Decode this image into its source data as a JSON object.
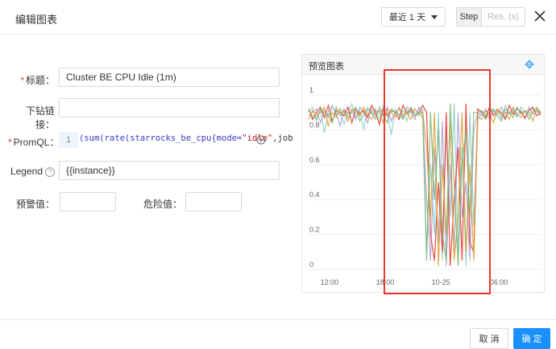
{
  "header": {
    "title": "编辑图表",
    "time_range": "最近 1 天",
    "step_label": "Step",
    "res_placeholder": "Res. (s)"
  },
  "form": {
    "title_label": "标题：",
    "title_value": "Cluster BE CPU Idle (1m)",
    "drilldown_label": "下钻链接：",
    "drilldown_value": "",
    "promql_label": "PromQL：",
    "promql_line_no": "1",
    "promql_code": {
      "p1": "(sum(rate(starrocks_be_cpu{mode=",
      "p2": "\"idle\"",
      "p3": ",job"
    },
    "legend_label": "Legend",
    "legend_value": "{{instance}}",
    "warning_label": "预警值：",
    "warning_value": "",
    "danger_label": "危险值：",
    "danger_value": ""
  },
  "preview": {
    "title": "预览图表"
  },
  "footer": {
    "cancel_label": "取 消",
    "ok_label": "确 定"
  },
  "colors": {
    "accent": "#1890ff",
    "highlight_box": "#e8382f",
    "series": [
      "#8dd3c7",
      "#b0a0d8",
      "#e8382f",
      "#d9a035",
      "#7fb87a"
    ]
  },
  "chart_data": {
    "type": "line",
    "x_ticks": [
      "12:00",
      "18:00",
      "10-25",
      "06:00"
    ],
    "y_ticks": [
      "1",
      "0.8",
      "0.6",
      "0.4",
      "0.2",
      "0"
    ],
    "ylim": [
      0,
      1
    ],
    "grid": true,
    "legend": "none",
    "series": [
      {
        "values": [
          0.9,
          0.93,
          0.85,
          0.92,
          0.78,
          0.91,
          0.94,
          0.88,
          0.92,
          0.83,
          0.9,
          0.95,
          0.87,
          0.91,
          0.8,
          0.93,
          0.89,
          0.92,
          0.86,
          0.94,
          0.9,
          0.77,
          0.92,
          0.88,
          0.91,
          0.85,
          0.93,
          0.9,
          0.88,
          0.92,
          0.1,
          0.6,
          0.2,
          0.9,
          0.05,
          0.8,
          0.3,
          0.95,
          0.1,
          0.7,
          0.02,
          0.9,
          0.25,
          0.85,
          0.91,
          0.88,
          0.93,
          0.9,
          0.92,
          0.86,
          0.94,
          0.89,
          0.91,
          0.87,
          0.93,
          0.9,
          0.88,
          0.92,
          0.9,
          0.91
        ]
      },
      {
        "values": [
          0.88,
          0.9,
          0.92,
          0.84,
          0.91,
          0.87,
          0.93,
          0.9,
          0.82,
          0.92,
          0.89,
          0.91,
          0.86,
          0.93,
          0.9,
          0.84,
          0.92,
          0.88,
          0.91,
          0.89,
          0.93,
          0.85,
          0.9,
          0.92,
          0.87,
          0.91,
          0.9,
          0.86,
          0.93,
          0.89,
          0.4,
          0.05,
          0.7,
          0.15,
          0.85,
          0.02,
          0.6,
          0.1,
          0.9,
          0.3,
          0.5,
          0.05,
          0.8,
          0.9,
          0.88,
          0.92,
          0.86,
          0.91,
          0.89,
          0.93,
          0.87,
          0.9,
          0.92,
          0.88,
          0.91,
          0.86,
          0.93,
          0.89,
          0.91,
          0.88
        ]
      },
      {
        "values": [
          0.92,
          0.86,
          0.9,
          0.93,
          0.87,
          0.94,
          0.85,
          0.91,
          0.9,
          0.88,
          0.93,
          0.84,
          0.92,
          0.89,
          0.91,
          0.87,
          0.94,
          0.9,
          0.83,
          0.92,
          0.88,
          0.91,
          0.9,
          0.86,
          0.94,
          0.89,
          0.92,
          0.88,
          0.9,
          0.94,
          0.9,
          0.2,
          0.05,
          0.5,
          0.1,
          0.9,
          0.02,
          0.4,
          0.7,
          0.05,
          0.95,
          0.15,
          0.1,
          0.92,
          0.9,
          0.87,
          0.93,
          0.88,
          0.91,
          0.9,
          0.86,
          0.94,
          0.89,
          0.92,
          0.9,
          0.87,
          0.91,
          0.93,
          0.88,
          0.9
        ]
      },
      {
        "values": [
          0.86,
          0.91,
          0.88,
          0.9,
          0.93,
          0.82,
          0.9,
          0.87,
          0.92,
          0.9,
          0.85,
          0.92,
          0.9,
          0.88,
          0.93,
          0.89,
          0.86,
          0.91,
          0.9,
          0.84,
          0.92,
          0.9,
          0.87,
          0.93,
          0.88,
          0.9,
          0.86,
          0.92,
          0.89,
          0.9,
          0.7,
          0.3,
          0.9,
          0.02,
          0.6,
          0.2,
          0.85,
          0.05,
          0.3,
          0.9,
          0.1,
          0.6,
          0.05,
          0.88,
          0.86,
          0.91,
          0.89,
          0.84,
          0.92,
          0.88,
          0.9,
          0.86,
          0.93,
          0.89,
          0.87,
          0.91,
          0.9,
          0.85,
          0.92,
          0.89
        ]
      },
      {
        "values": [
          0.91,
          0.88,
          0.86,
          0.92,
          0.9,
          0.89,
          0.84,
          0.93,
          0.88,
          0.91,
          0.87,
          0.9,
          0.93,
          0.85,
          0.89,
          0.92,
          0.9,
          0.86,
          0.93,
          0.88,
          0.84,
          0.92,
          0.9,
          0.89,
          0.86,
          0.93,
          0.91,
          0.88,
          0.9,
          0.87,
          0.05,
          0.9,
          0.4,
          0.8,
          0.2,
          0.05,
          0.95,
          0.5,
          0.02,
          0.6,
          0.8,
          0.3,
          0.9,
          0.9,
          0.91,
          0.86,
          0.9,
          0.92,
          0.88,
          0.85,
          0.92,
          0.9,
          0.87,
          0.93,
          0.89,
          0.91,
          0.86,
          0.9,
          0.93,
          0.9
        ]
      }
    ]
  }
}
